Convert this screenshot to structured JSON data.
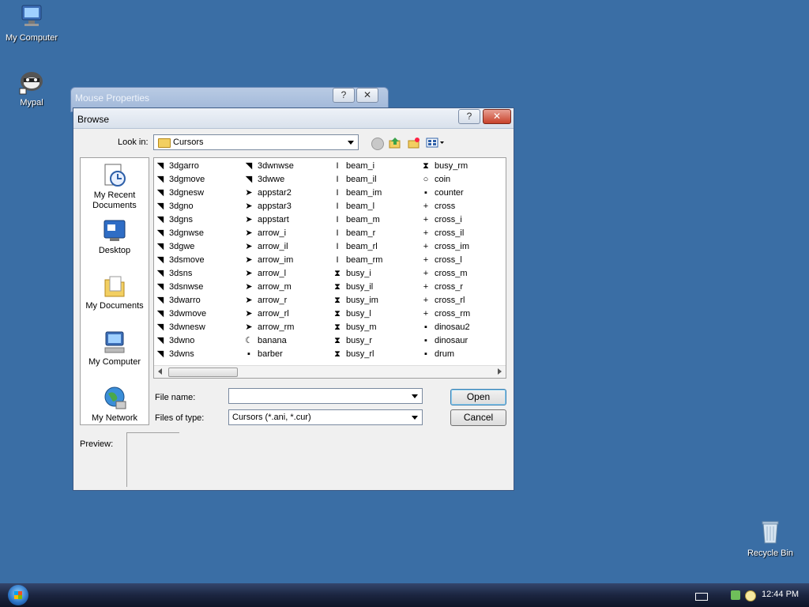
{
  "desktop": {
    "icons": [
      {
        "label": "My Computer"
      },
      {
        "label": "Mypal"
      },
      {
        "label": "Recycle Bin"
      }
    ]
  },
  "mouse_properties": {
    "title": "Mouse Properties",
    "help": "?",
    "close": "✕"
  },
  "browse": {
    "title": "Browse",
    "help": "?",
    "close": "✕",
    "look_in_label": "Look in:",
    "look_in_value": "Cursors",
    "places": [
      {
        "label": "My Recent Documents"
      },
      {
        "label": "Desktop"
      },
      {
        "label": "My Documents"
      },
      {
        "label": "My Computer"
      },
      {
        "label": "My Network"
      }
    ],
    "files": [
      [
        "3dgarro",
        "3dgmove",
        "3dgnesw",
        "3dgno",
        "3dgns",
        "3dgnwse",
        "3dgwe",
        "3dsmove",
        "3dsns",
        "3dsnwse",
        "3dwarro",
        "3dwmove",
        "3dwnesw",
        "3dwno",
        "3dwns"
      ],
      [
        "3dwnwse",
        "3dwwe",
        "appstar2",
        "appstar3",
        "appstart",
        "arrow_i",
        "arrow_il",
        "arrow_im",
        "arrow_l",
        "arrow_m",
        "arrow_r",
        "arrow_rl",
        "arrow_rm",
        "banana",
        "barber"
      ],
      [
        "beam_i",
        "beam_il",
        "beam_im",
        "beam_l",
        "beam_m",
        "beam_r",
        "beam_rl",
        "beam_rm",
        "busy_i",
        "busy_il",
        "busy_im",
        "busy_l",
        "busy_m",
        "busy_r",
        "busy_rl"
      ],
      [
        "busy_rm",
        "coin",
        "counter",
        "cross",
        "cross_i",
        "cross_il",
        "cross_im",
        "cross_l",
        "cross_m",
        "cross_r",
        "cross_rl",
        "cross_rm",
        "dinosau2",
        "dinosaur",
        "drum"
      ]
    ],
    "file_name_label": "File name:",
    "file_name_value": "",
    "files_of_type_label": "Files of type:",
    "files_of_type_value": "Cursors (*.ani, *.cur)",
    "open_label": "Open",
    "cancel_label": "Cancel",
    "preview_label": "Preview:"
  },
  "taskbar": {
    "clock": "12:44 PM"
  }
}
